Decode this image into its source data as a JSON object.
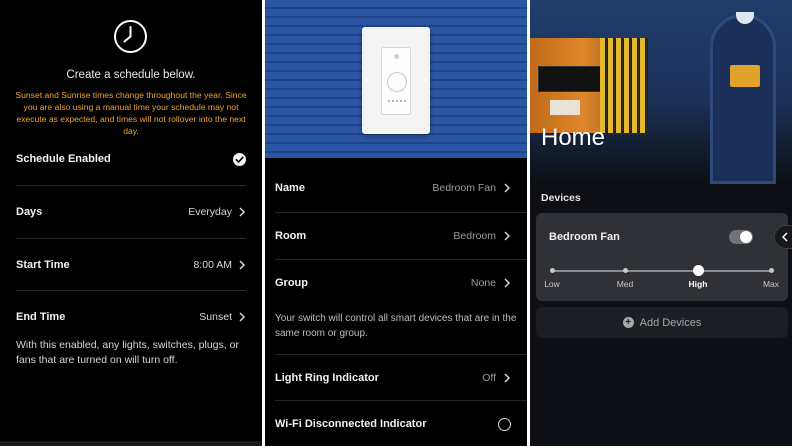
{
  "schedule": {
    "title": "Create a schedule below.",
    "warning": "Sunset and Sunrise times change throughout the year. Since you are also using a manual time your schedule may not execute as expected, and times will not rollover into the next day.",
    "rows": [
      {
        "label": "Schedule Enabled",
        "value": ""
      },
      {
        "label": "Days",
        "value": "Everyday"
      },
      {
        "label": "Start Time",
        "value": "8:00 AM"
      },
      {
        "label": "End Time",
        "value": "Sunset"
      }
    ],
    "note": "With this enabled, any lights, switches, plugs, or fans that are turned on will turn off.",
    "warning_color": "#f0a330"
  },
  "device_settings": {
    "rows": [
      {
        "label": "Name",
        "value": "Bedroom Fan"
      },
      {
        "label": "Room",
        "value": "Bedroom"
      },
      {
        "label": "Group",
        "value": "None"
      },
      {
        "label": "Light Ring Indicator",
        "value": "Off"
      },
      {
        "label": "Wi-Fi Disconnected Indicator",
        "value": ""
      }
    ],
    "note": "Your switch will control all smart devices that are in the same room or group."
  },
  "home": {
    "title": "Home",
    "section_label": "Devices",
    "device": {
      "name": "Bedroom Fan",
      "toggle_on": true,
      "speeds": [
        "Low",
        "Med",
        "High",
        "Max"
      ],
      "selected_speed": "High"
    },
    "add_label": "Add Devices"
  },
  "icons": [
    "clock-icon",
    "check-icon",
    "chevron-right-icon",
    "chevron-left-icon",
    "plus-icon",
    "radio-icon"
  ]
}
